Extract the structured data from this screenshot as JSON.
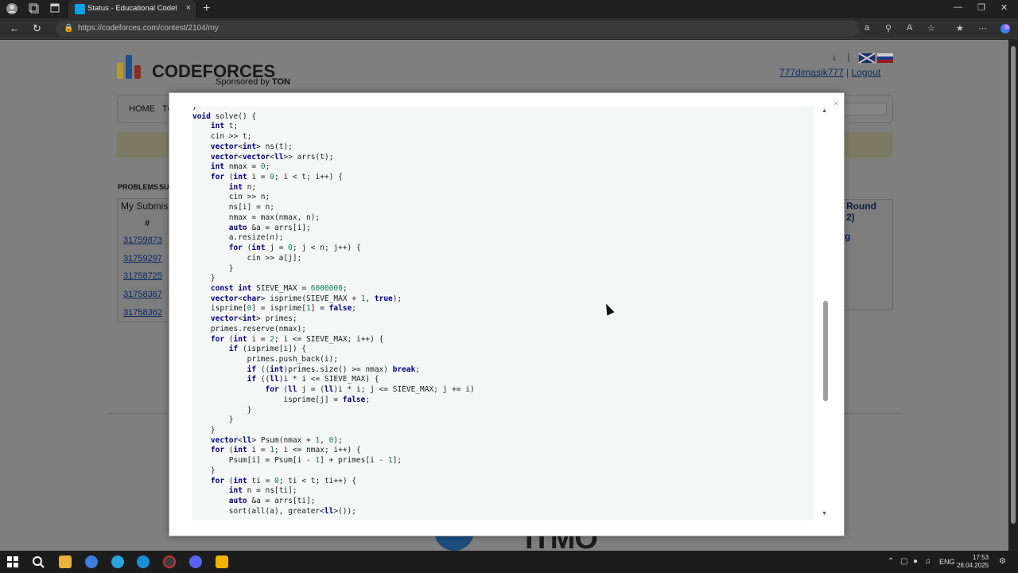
{
  "browser": {
    "tab_title": "Status - Educational Codeforces R",
    "url": "https://codeforces.com/contest/2104/my",
    "new_tab_symbol": "+",
    "tab_close_symbol": "×"
  },
  "page": {
    "logo_text": "CODEFORCES",
    "sponsored_prefix": "Sponsored by",
    "sponsor": "TON",
    "username": "777dimasik777",
    "separator": "|",
    "logout": "Logout",
    "menu_home": "HOME",
    "menu_partial": "TO",
    "problems_tab": "PROBLEMS",
    "submit_tab": "SUB",
    "submissions_header": "My Submis",
    "hash_header": "#",
    "submission_ids": [
      "31759873",
      "31759297",
      "31758725",
      "31758367",
      "31758362"
    ],
    "round_title_1": "Round",
    "round_title_2": "2)",
    "round_link": "g",
    "footer_brand": "ITMO"
  },
  "modal": {
    "close_symbol": "×",
    "code": [
      "}",
      "void solve() {",
      "    int t;",
      "    cin >> t;",
      "    vector<int> ns(t);",
      "    vector<vector<ll>> arrs(t);",
      "    int nmax = 0;",
      "    for (int i = 0; i < t; i++) {",
      "        int n;",
      "        cin >> n;",
      "        ns[i] = n;",
      "        nmax = max(nmax, n);",
      "        auto &a = arrs[i];",
      "        a.resize(n);",
      "        for (int j = 0; j < n; j++) {",
      "            cin >> a[j];",
      "        }",
      "    }",
      "    const int SIEVE_MAX = 6000000;",
      "    vector<char> isprime(SIEVE_MAX + 1, true);",
      "    isprime[0] = isprime[1] = false;",
      "    vector<int> primes;",
      "    primes.reserve(nmax);",
      "    for (int i = 2; i <= SIEVE_MAX; i++) {",
      "        if (isprime[i]) {",
      "            primes.push_back(i);",
      "            if ((int)primes.size() >= nmax) break;",
      "            if ((ll)i * i <= SIEVE_MAX) {",
      "                for (ll j = (ll)i * i; j <= SIEVE_MAX; j += i)",
      "                    isprime[j] = false;",
      "            }",
      "        }",
      "    }",
      "    vector<ll> Psum(nmax + 1, 0);",
      "    for (int i = 1; i <= nmax; i++) {",
      "        Psum[i] = Psum[i - 1] + primes[i - 1];",
      "    }",
      "    for (int ti = 0; ti < t; ti++) {",
      "        int n = ns[ti];",
      "        auto &a = arrs[ti];",
      "        sort(all(a), greater<ll>());"
    ]
  },
  "taskbar": {
    "lang": "ENG",
    "time": "17:53",
    "date": "28.04.2025"
  }
}
